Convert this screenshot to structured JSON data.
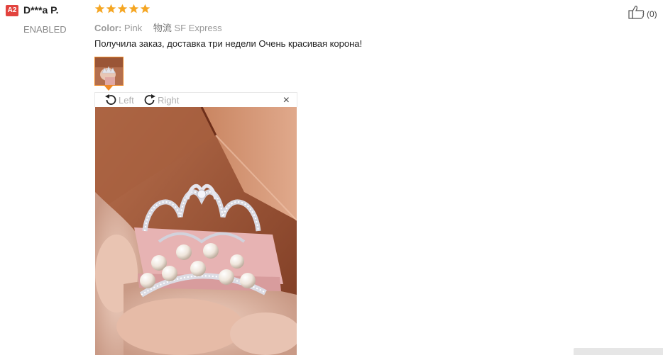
{
  "user": {
    "country_code": "A2",
    "name": "D***a P.",
    "status": "ENABLED"
  },
  "review": {
    "rating": 5,
    "color_label": "Color:",
    "color_value": "Pink",
    "shipping_label": "物流",
    "shipping_value": "SF Express",
    "text": "Получила заказ, доставка три недели Очень красивая корона!",
    "thumbnail_count": 1
  },
  "viewer": {
    "rotate_left_label": "Left",
    "rotate_right_label": "Right",
    "close_label": "×"
  },
  "like": {
    "count": "(0)"
  },
  "colors": {
    "accent": "#f08a27",
    "star": "#f5a623",
    "badge": "#e2433e"
  },
  "icons": [
    "flag-badge",
    "star-icon",
    "rotate-left-icon",
    "rotate-right-icon",
    "close-icon",
    "thumb-up-icon"
  ]
}
